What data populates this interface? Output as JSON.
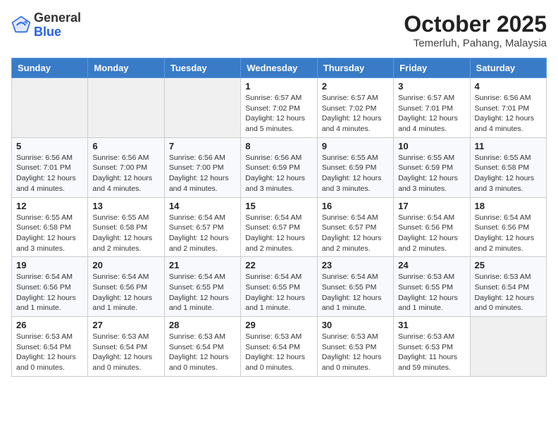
{
  "header": {
    "logo_general": "General",
    "logo_blue": "Blue",
    "month_title": "October 2025",
    "location": "Temerluh, Pahang, Malaysia"
  },
  "days_of_week": [
    "Sunday",
    "Monday",
    "Tuesday",
    "Wednesday",
    "Thursday",
    "Friday",
    "Saturday"
  ],
  "weeks": [
    [
      {
        "day": "",
        "info": ""
      },
      {
        "day": "",
        "info": ""
      },
      {
        "day": "",
        "info": ""
      },
      {
        "day": "1",
        "info": "Sunrise: 6:57 AM\nSunset: 7:02 PM\nDaylight: 12 hours\nand 5 minutes."
      },
      {
        "day": "2",
        "info": "Sunrise: 6:57 AM\nSunset: 7:02 PM\nDaylight: 12 hours\nand 4 minutes."
      },
      {
        "day": "3",
        "info": "Sunrise: 6:57 AM\nSunset: 7:01 PM\nDaylight: 12 hours\nand 4 minutes."
      },
      {
        "day": "4",
        "info": "Sunrise: 6:56 AM\nSunset: 7:01 PM\nDaylight: 12 hours\nand 4 minutes."
      }
    ],
    [
      {
        "day": "5",
        "info": "Sunrise: 6:56 AM\nSunset: 7:01 PM\nDaylight: 12 hours\nand 4 minutes."
      },
      {
        "day": "6",
        "info": "Sunrise: 6:56 AM\nSunset: 7:00 PM\nDaylight: 12 hours\nand 4 minutes."
      },
      {
        "day": "7",
        "info": "Sunrise: 6:56 AM\nSunset: 7:00 PM\nDaylight: 12 hours\nand 4 minutes."
      },
      {
        "day": "8",
        "info": "Sunrise: 6:56 AM\nSunset: 6:59 PM\nDaylight: 12 hours\nand 3 minutes."
      },
      {
        "day": "9",
        "info": "Sunrise: 6:55 AM\nSunset: 6:59 PM\nDaylight: 12 hours\nand 3 minutes."
      },
      {
        "day": "10",
        "info": "Sunrise: 6:55 AM\nSunset: 6:59 PM\nDaylight: 12 hours\nand 3 minutes."
      },
      {
        "day": "11",
        "info": "Sunrise: 6:55 AM\nSunset: 6:58 PM\nDaylight: 12 hours\nand 3 minutes."
      }
    ],
    [
      {
        "day": "12",
        "info": "Sunrise: 6:55 AM\nSunset: 6:58 PM\nDaylight: 12 hours\nand 3 minutes."
      },
      {
        "day": "13",
        "info": "Sunrise: 6:55 AM\nSunset: 6:58 PM\nDaylight: 12 hours\nand 2 minutes."
      },
      {
        "day": "14",
        "info": "Sunrise: 6:54 AM\nSunset: 6:57 PM\nDaylight: 12 hours\nand 2 minutes."
      },
      {
        "day": "15",
        "info": "Sunrise: 6:54 AM\nSunset: 6:57 PM\nDaylight: 12 hours\nand 2 minutes."
      },
      {
        "day": "16",
        "info": "Sunrise: 6:54 AM\nSunset: 6:57 PM\nDaylight: 12 hours\nand 2 minutes."
      },
      {
        "day": "17",
        "info": "Sunrise: 6:54 AM\nSunset: 6:56 PM\nDaylight: 12 hours\nand 2 minutes."
      },
      {
        "day": "18",
        "info": "Sunrise: 6:54 AM\nSunset: 6:56 PM\nDaylight: 12 hours\nand 2 minutes."
      }
    ],
    [
      {
        "day": "19",
        "info": "Sunrise: 6:54 AM\nSunset: 6:56 PM\nDaylight: 12 hours\nand 1 minute."
      },
      {
        "day": "20",
        "info": "Sunrise: 6:54 AM\nSunset: 6:56 PM\nDaylight: 12 hours\nand 1 minute."
      },
      {
        "day": "21",
        "info": "Sunrise: 6:54 AM\nSunset: 6:55 PM\nDaylight: 12 hours\nand 1 minute."
      },
      {
        "day": "22",
        "info": "Sunrise: 6:54 AM\nSunset: 6:55 PM\nDaylight: 12 hours\nand 1 minute."
      },
      {
        "day": "23",
        "info": "Sunrise: 6:54 AM\nSunset: 6:55 PM\nDaylight: 12 hours\nand 1 minute."
      },
      {
        "day": "24",
        "info": "Sunrise: 6:53 AM\nSunset: 6:55 PM\nDaylight: 12 hours\nand 1 minute."
      },
      {
        "day": "25",
        "info": "Sunrise: 6:53 AM\nSunset: 6:54 PM\nDaylight: 12 hours\nand 0 minutes."
      }
    ],
    [
      {
        "day": "26",
        "info": "Sunrise: 6:53 AM\nSunset: 6:54 PM\nDaylight: 12 hours\nand 0 minutes."
      },
      {
        "day": "27",
        "info": "Sunrise: 6:53 AM\nSunset: 6:54 PM\nDaylight: 12 hours\nand 0 minutes."
      },
      {
        "day": "28",
        "info": "Sunrise: 6:53 AM\nSunset: 6:54 PM\nDaylight: 12 hours\nand 0 minutes."
      },
      {
        "day": "29",
        "info": "Sunrise: 6:53 AM\nSunset: 6:54 PM\nDaylight: 12 hours\nand 0 minutes."
      },
      {
        "day": "30",
        "info": "Sunrise: 6:53 AM\nSunset: 6:53 PM\nDaylight: 12 hours\nand 0 minutes."
      },
      {
        "day": "31",
        "info": "Sunrise: 6:53 AM\nSunset: 6:53 PM\nDaylight: 11 hours\nand 59 minutes."
      },
      {
        "day": "",
        "info": ""
      }
    ]
  ]
}
